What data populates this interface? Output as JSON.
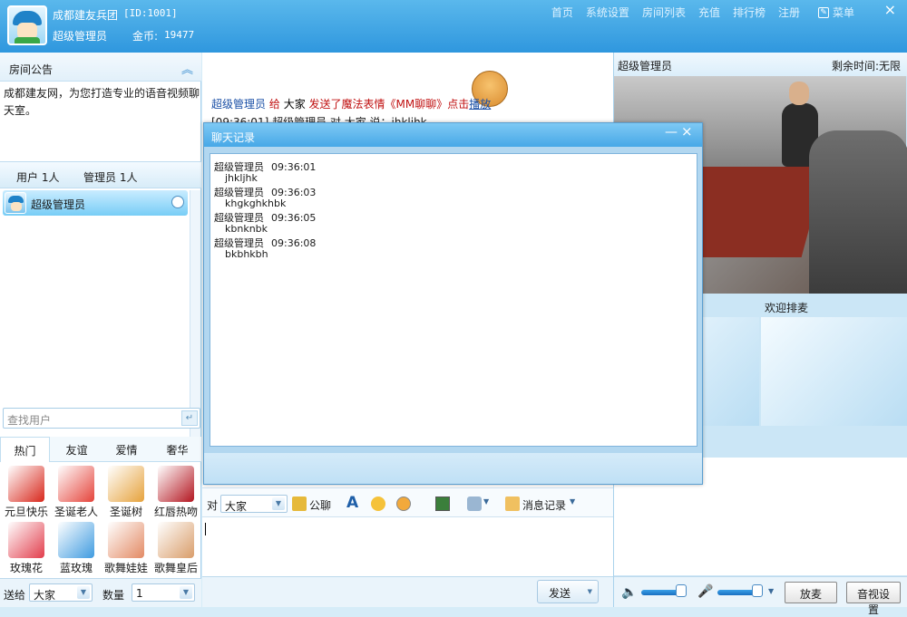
{
  "header": {
    "group_name": "成都建友兵团",
    "room_id": "[ID:1001]",
    "user_role": "超级管理员",
    "coins_label": "金币:",
    "coins_value": "19477",
    "nav": [
      "首页",
      "系统设置",
      "房间列表",
      "充值",
      "排行榜",
      "注册"
    ],
    "menu_label": "菜单",
    "close_glyph": "×"
  },
  "left": {
    "notice_title": "房间公告",
    "notice_text": "成都建友网，为您打造专业的语音视频聊天室。",
    "tab_users": "用户 1人",
    "tab_admins": "管理员 1人",
    "users": [
      {
        "name": "超级管理员"
      }
    ],
    "search_placeholder": "查找用户",
    "gift_tabs": [
      "热门",
      "友谊",
      "爱情",
      "奢华"
    ],
    "gifts": [
      {
        "label": "元旦快乐",
        "color": "#d8271b"
      },
      {
        "label": "圣诞老人",
        "color": "#e5433a"
      },
      {
        "label": "圣诞树",
        "color": "#e6a23c"
      },
      {
        "label": "红唇热吻",
        "color": "#b3151f"
      },
      {
        "label": "玫瑰花",
        "color": "#e23d4c"
      },
      {
        "label": "蓝玫瑰",
        "color": "#3f9be0"
      },
      {
        "label": "歌舞娃娃",
        "color": "#e38a64"
      },
      {
        "label": "歌舞皇后",
        "color": "#d99d6a"
      }
    ],
    "send_to_label": "送给",
    "send_to_value": "大家",
    "quantity_label": "数量",
    "quantity_value": "1"
  },
  "center": {
    "chat_sender": "超级管理员",
    "chat_to_word": "给",
    "chat_target": "大家",
    "chat_action": "发送了魔法表情《MM聊聊》点击",
    "chat_play": "播放",
    "chat_line2": "[09:36:01] 超级管理员 对 大家 说：jhkljhk",
    "to_label": "对",
    "to_value": "大家",
    "public_chat": "公聊",
    "msg_record": "消息记录",
    "send_button": "发送"
  },
  "right": {
    "host_name": "超级管理员",
    "time_left": "剩余时间:无限",
    "mic_queue_title": "欢迎排麦",
    "release_mic": "放麦",
    "av_settings": "音视设置"
  },
  "modal": {
    "title": "聊天记录",
    "min_glyph": "—",
    "close_glyph": "×",
    "records": [
      {
        "user": "超级管理员",
        "time": "09:36:01",
        "msg": "jhkljhk"
      },
      {
        "user": "超级管理员",
        "time": "09:36:03",
        "msg": "khgkghkhbk"
      },
      {
        "user": "超级管理员",
        "time": "09:36:05",
        "msg": "kbnknbk"
      },
      {
        "user": "超级管理员",
        "time": "09:36:08",
        "msg": "bkbhkbh"
      }
    ]
  }
}
